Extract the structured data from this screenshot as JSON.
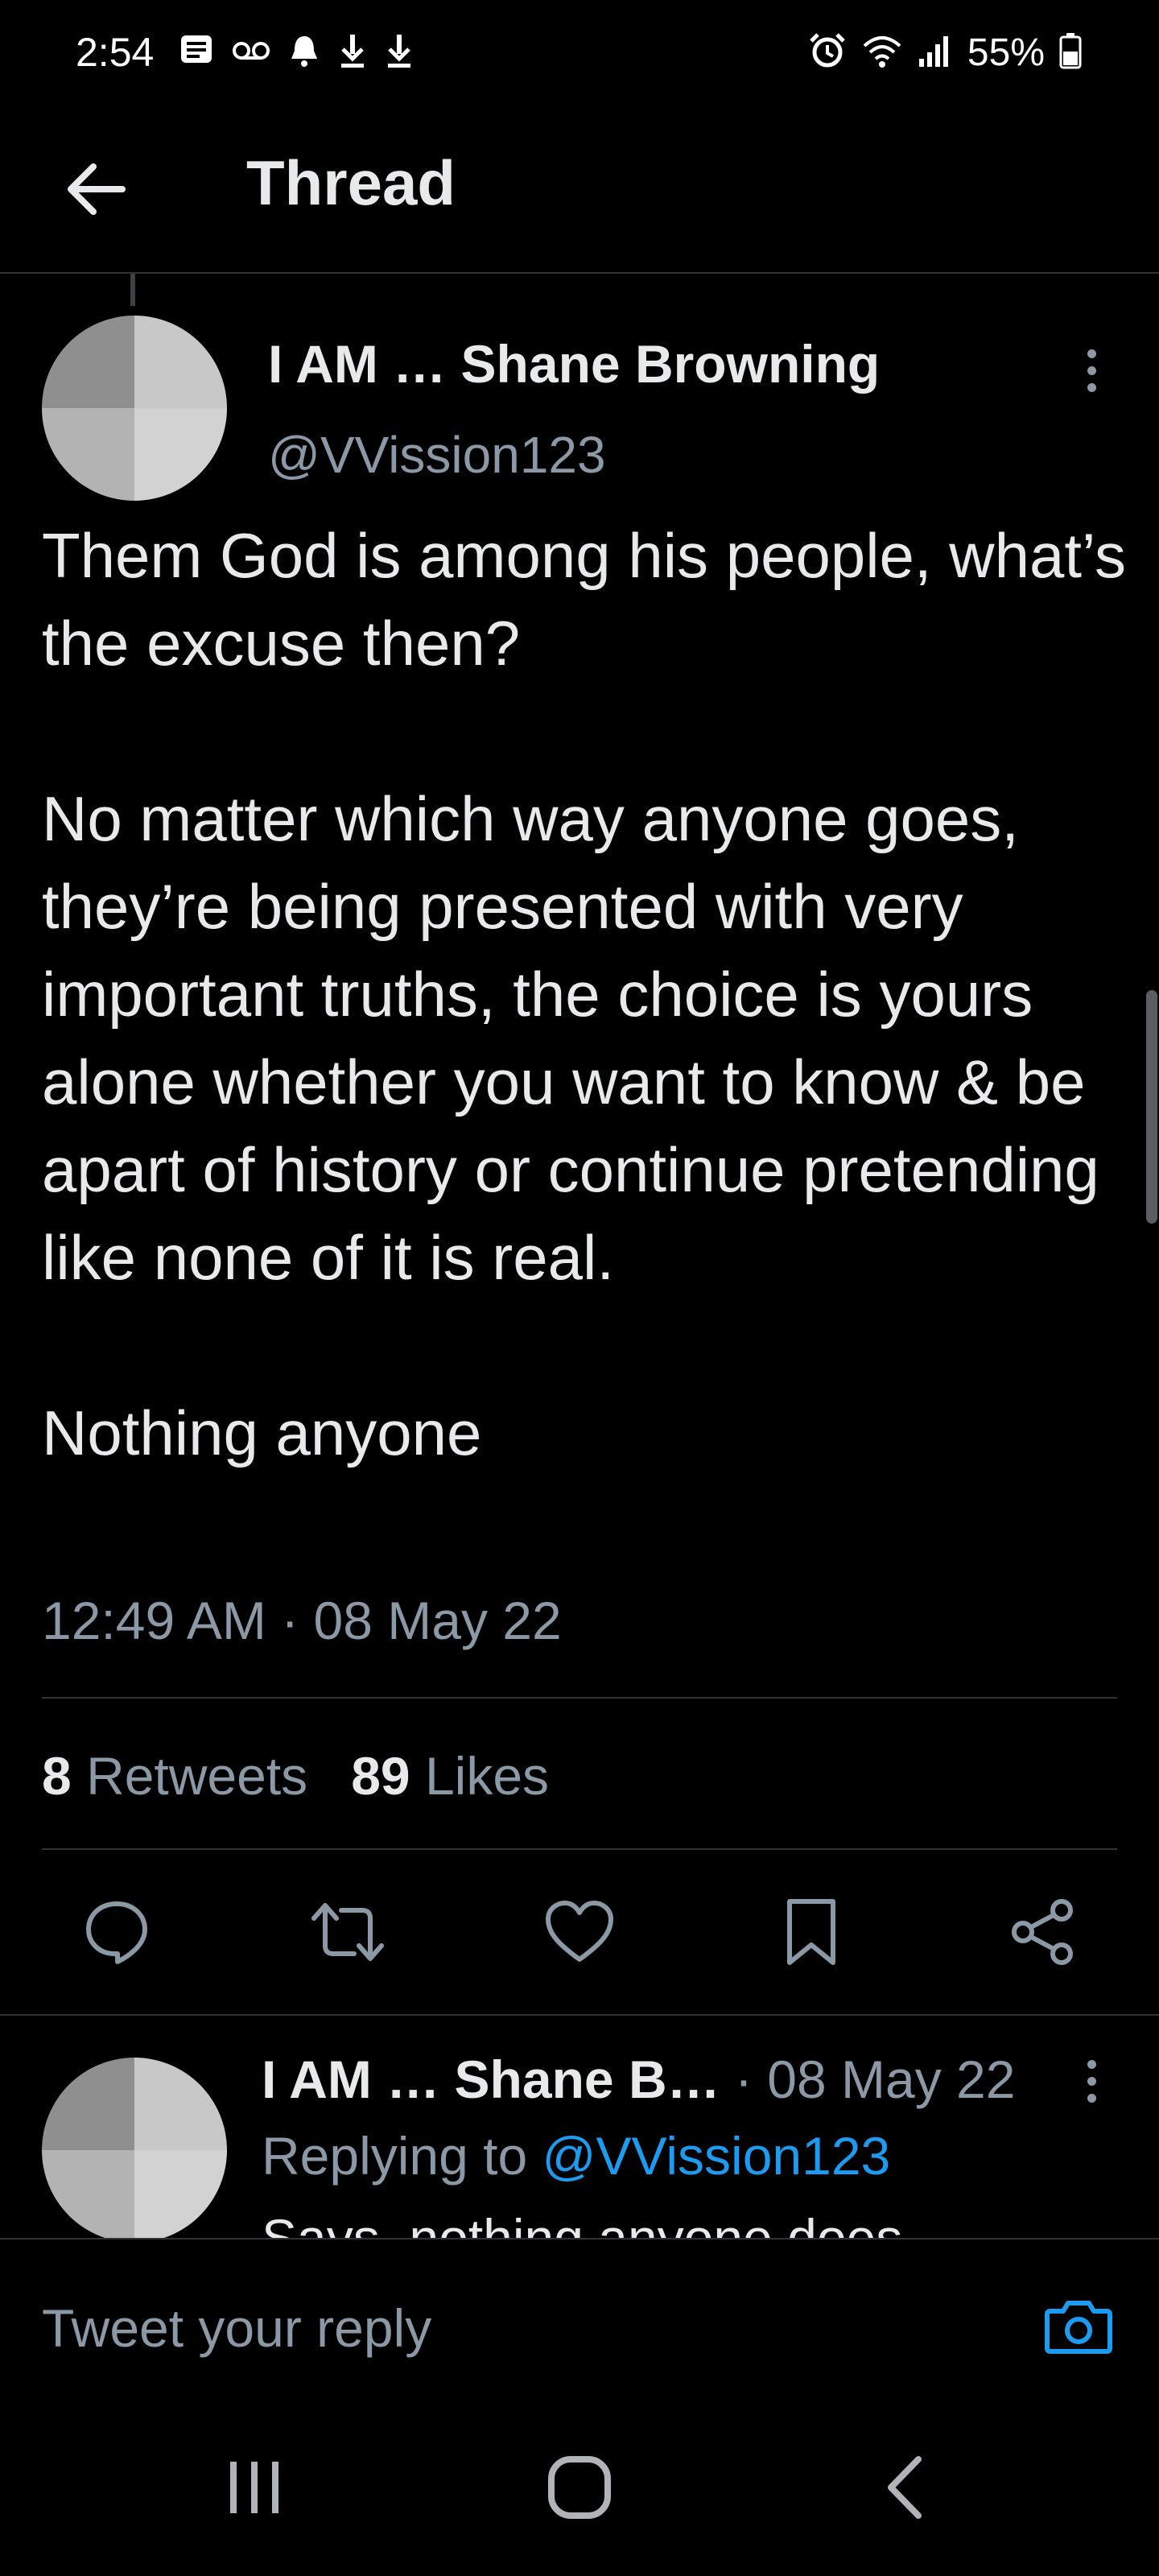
{
  "status_bar": {
    "time": "2:54",
    "battery_percent": "55%",
    "left_icons": [
      "message-icon",
      "voicemail-icon",
      "notification-bell-icon",
      "download-icon",
      "download-icon"
    ],
    "right_icons": [
      "alarm-icon",
      "wifi-icon",
      "signal-icon",
      "battery-icon"
    ]
  },
  "header": {
    "title": "Thread"
  },
  "main_tweet": {
    "author_name": "I AM … Shane Browning",
    "handle": "@VVission123",
    "text": "Them God is among his people, what’s the excuse then?\n\nNo matter which way anyone goes, they’re being presented with very important truths, the choice is yours alone whether you want to know & be apart of history or continue pretending like none of it is real.\n\nNothing anyone",
    "timestamp": "12:49 AM · 08 May 22",
    "retweets_count": "8",
    "retweets_label": "Retweets",
    "likes_count": "89",
    "likes_label": "Likes"
  },
  "actions": [
    "reply-icon",
    "retweet-icon",
    "like-icon",
    "bookmark-icon",
    "share-icon"
  ],
  "reply_tweet": {
    "author_name": "I AM … Shane B…",
    "meta": " · 08 May 22",
    "replying_prefix": "Replying to ",
    "replying_handle": "@VVission123",
    "text": "Says, nothing anyone does"
  },
  "composer": {
    "placeholder": "Tweet your reply"
  },
  "colors": {
    "background": "#000000",
    "text": "#e7e9ea",
    "muted": "#8b98a5",
    "accent": "#1d9bf0"
  }
}
